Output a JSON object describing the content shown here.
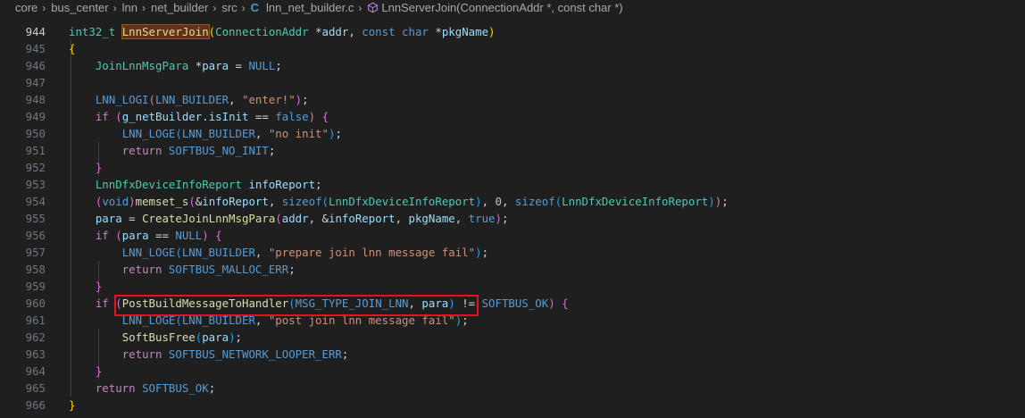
{
  "breadcrumb": {
    "parts": [
      "core",
      "bus_center",
      "lnn",
      "net_builder",
      "src"
    ],
    "file_icon_letter": "C",
    "file_name": "lnn_net_builder.c",
    "symbol": "LnnServerJoin(ConnectionAddr *, const char *)"
  },
  "colors": {
    "background": "#1f1f1f",
    "highlight_box": "#e81123",
    "keyword": "#569cd6",
    "control": "#c586c0",
    "type": "#4ec9b0",
    "function": "#dcdcaa",
    "variable": "#9cdcfe",
    "string": "#ce9178",
    "number": "#b5cea8"
  },
  "editor": {
    "active_line": "944",
    "lines": [
      {
        "n": "944",
        "tokens": [
          {
            "t": "int32_t",
            "c": "ty"
          },
          {
            "t": " ",
            "c": ""
          },
          {
            "t": "LnnServerJoin",
            "c": "fn sel"
          },
          {
            "t": "(",
            "c": "br1"
          },
          {
            "t": "ConnectionAddr",
            "c": "ty"
          },
          {
            "t": " *",
            "c": "pu"
          },
          {
            "t": "addr",
            "c": "va"
          },
          {
            "t": ", ",
            "c": "pu"
          },
          {
            "t": "const",
            "c": "k"
          },
          {
            "t": " ",
            "c": ""
          },
          {
            "t": "char",
            "c": "k"
          },
          {
            "t": " *",
            "c": "pu"
          },
          {
            "t": "pkgName",
            "c": "va"
          },
          {
            "t": ")",
            "c": "br1"
          }
        ]
      },
      {
        "n": "945",
        "tokens": [
          {
            "t": "{",
            "c": "br1"
          }
        ]
      },
      {
        "n": "946",
        "tokens": [
          {
            "t": "    ",
            "c": ""
          },
          {
            "t": "JoinLnnMsgPara",
            "c": "ty"
          },
          {
            "t": " *",
            "c": "pu"
          },
          {
            "t": "para",
            "c": "va"
          },
          {
            "t": " = ",
            "c": "pu"
          },
          {
            "t": "NULL",
            "c": "mc"
          },
          {
            "t": ";",
            "c": "pu"
          }
        ]
      },
      {
        "n": "947",
        "tokens": []
      },
      {
        "n": "948",
        "tokens": [
          {
            "t": "    ",
            "c": ""
          },
          {
            "t": "LNN_LOGI",
            "c": "mc"
          },
          {
            "t": "(",
            "c": "br2"
          },
          {
            "t": "LNN_BUILDER",
            "c": "mc"
          },
          {
            "t": ", ",
            "c": "pu"
          },
          {
            "t": "\"enter!\"",
            "c": "st"
          },
          {
            "t": ")",
            "c": "br2"
          },
          {
            "t": ";",
            "c": "pu"
          }
        ]
      },
      {
        "n": "949",
        "tokens": [
          {
            "t": "    ",
            "c": ""
          },
          {
            "t": "if",
            "c": "cf"
          },
          {
            "t": " ",
            "c": ""
          },
          {
            "t": "(",
            "c": "br2"
          },
          {
            "t": "g_netBuilder",
            "c": "va"
          },
          {
            "t": ".",
            "c": "pu"
          },
          {
            "t": "isInit",
            "c": "va"
          },
          {
            "t": " == ",
            "c": "pu"
          },
          {
            "t": "false",
            "c": "k"
          },
          {
            "t": ")",
            "c": "br2"
          },
          {
            "t": " ",
            "c": ""
          },
          {
            "t": "{",
            "c": "br2"
          }
        ]
      },
      {
        "n": "950",
        "tokens": [
          {
            "t": "        ",
            "c": ""
          },
          {
            "t": "LNN_LOGE",
            "c": "mc"
          },
          {
            "t": "(",
            "c": "br3"
          },
          {
            "t": "LNN_BUILDER",
            "c": "mc"
          },
          {
            "t": ", ",
            "c": "pu"
          },
          {
            "t": "\"no init\"",
            "c": "st"
          },
          {
            "t": ")",
            "c": "br3"
          },
          {
            "t": ";",
            "c": "pu"
          }
        ]
      },
      {
        "n": "951",
        "tokens": [
          {
            "t": "        ",
            "c": ""
          },
          {
            "t": "return",
            "c": "cf"
          },
          {
            "t": " ",
            "c": ""
          },
          {
            "t": "SOFTBUS_NO_INIT",
            "c": "mc"
          },
          {
            "t": ";",
            "c": "pu"
          }
        ]
      },
      {
        "n": "952",
        "tokens": [
          {
            "t": "    ",
            "c": ""
          },
          {
            "t": "}",
            "c": "br2"
          }
        ]
      },
      {
        "n": "953",
        "tokens": [
          {
            "t": "    ",
            "c": ""
          },
          {
            "t": "LnnDfxDeviceInfoReport",
            "c": "ty"
          },
          {
            "t": " ",
            "c": ""
          },
          {
            "t": "infoReport",
            "c": "va"
          },
          {
            "t": ";",
            "c": "pu"
          }
        ]
      },
      {
        "n": "954",
        "tokens": [
          {
            "t": "    ",
            "c": ""
          },
          {
            "t": "(",
            "c": "br2"
          },
          {
            "t": "void",
            "c": "k"
          },
          {
            "t": ")",
            "c": "br2"
          },
          {
            "t": "memset_s",
            "c": "fn"
          },
          {
            "t": "(",
            "c": "br2"
          },
          {
            "t": "&",
            "c": "pu"
          },
          {
            "t": "infoReport",
            "c": "va"
          },
          {
            "t": ", ",
            "c": "pu"
          },
          {
            "t": "sizeof",
            "c": "k"
          },
          {
            "t": "(",
            "c": "br3"
          },
          {
            "t": "LnnDfxDeviceInfoReport",
            "c": "ty"
          },
          {
            "t": ")",
            "c": "br3"
          },
          {
            "t": ", ",
            "c": "pu"
          },
          {
            "t": "0",
            "c": "nu"
          },
          {
            "t": ", ",
            "c": "pu"
          },
          {
            "t": "sizeof",
            "c": "k"
          },
          {
            "t": "(",
            "c": "br3"
          },
          {
            "t": "LnnDfxDeviceInfoReport",
            "c": "ty"
          },
          {
            "t": ")",
            "c": "br3"
          },
          {
            "t": ")",
            "c": "br2"
          },
          {
            "t": ";",
            "c": "pu"
          }
        ]
      },
      {
        "n": "955",
        "tokens": [
          {
            "t": "    ",
            "c": ""
          },
          {
            "t": "para",
            "c": "va"
          },
          {
            "t": " = ",
            "c": "pu"
          },
          {
            "t": "CreateJoinLnnMsgPara",
            "c": "fn"
          },
          {
            "t": "(",
            "c": "br2"
          },
          {
            "t": "addr",
            "c": "va"
          },
          {
            "t": ", ",
            "c": "pu"
          },
          {
            "t": "&",
            "c": "pu"
          },
          {
            "t": "infoReport",
            "c": "va"
          },
          {
            "t": ", ",
            "c": "pu"
          },
          {
            "t": "pkgName",
            "c": "va"
          },
          {
            "t": ", ",
            "c": "pu"
          },
          {
            "t": "true",
            "c": "k"
          },
          {
            "t": ")",
            "c": "br2"
          },
          {
            "t": ";",
            "c": "pu"
          }
        ]
      },
      {
        "n": "956",
        "tokens": [
          {
            "t": "    ",
            "c": ""
          },
          {
            "t": "if",
            "c": "cf"
          },
          {
            "t": " ",
            "c": ""
          },
          {
            "t": "(",
            "c": "br2"
          },
          {
            "t": "para",
            "c": "va"
          },
          {
            "t": " == ",
            "c": "pu"
          },
          {
            "t": "NULL",
            "c": "mc"
          },
          {
            "t": ")",
            "c": "br2"
          },
          {
            "t": " ",
            "c": ""
          },
          {
            "t": "{",
            "c": "br2"
          }
        ]
      },
      {
        "n": "957",
        "tokens": [
          {
            "t": "        ",
            "c": ""
          },
          {
            "t": "LNN_LOGE",
            "c": "mc"
          },
          {
            "t": "(",
            "c": "br3"
          },
          {
            "t": "LNN_BUILDER",
            "c": "mc"
          },
          {
            "t": ", ",
            "c": "pu"
          },
          {
            "t": "\"prepare join lnn message fail\"",
            "c": "st"
          },
          {
            "t": ")",
            "c": "br3"
          },
          {
            "t": ";",
            "c": "pu"
          }
        ]
      },
      {
        "n": "958",
        "tokens": [
          {
            "t": "        ",
            "c": ""
          },
          {
            "t": "return",
            "c": "cf"
          },
          {
            "t": " ",
            "c": ""
          },
          {
            "t": "SOFTBUS_MALLOC_ERR",
            "c": "mc"
          },
          {
            "t": ";",
            "c": "pu"
          }
        ]
      },
      {
        "n": "959",
        "tokens": [
          {
            "t": "    ",
            "c": ""
          },
          {
            "t": "}",
            "c": "br2"
          }
        ]
      },
      {
        "n": "960",
        "tokens": [
          {
            "t": "    ",
            "c": ""
          },
          {
            "t": "if",
            "c": "cf"
          },
          {
            "t": " ",
            "c": ""
          },
          {
            "t": "(",
            "c": "br2"
          },
          {
            "t": "PostBuildMessageToHandler",
            "c": "fn"
          },
          {
            "t": "(",
            "c": "br3"
          },
          {
            "t": "MSG_TYPE_JOIN_LNN",
            "c": "mc"
          },
          {
            "t": ", ",
            "c": "pu"
          },
          {
            "t": "para",
            "c": "va"
          },
          {
            "t": ")",
            "c": "br3"
          },
          {
            "t": " != ",
            "c": "pu"
          },
          {
            "t": "SOFTBUS_OK",
            "c": "mc"
          },
          {
            "t": ")",
            "c": "br2"
          },
          {
            "t": " ",
            "c": ""
          },
          {
            "t": "{",
            "c": "br2"
          }
        ]
      },
      {
        "n": "961",
        "tokens": [
          {
            "t": "        ",
            "c": ""
          },
          {
            "t": "LNN_LOGE",
            "c": "mc"
          },
          {
            "t": "(",
            "c": "br3"
          },
          {
            "t": "LNN_BUILDER",
            "c": "mc"
          },
          {
            "t": ", ",
            "c": "pu"
          },
          {
            "t": "\"post join lnn message fail\"",
            "c": "st"
          },
          {
            "t": ")",
            "c": "br3"
          },
          {
            "t": ";",
            "c": "pu"
          }
        ]
      },
      {
        "n": "962",
        "tokens": [
          {
            "t": "        ",
            "c": ""
          },
          {
            "t": "SoftBusFree",
            "c": "fn"
          },
          {
            "t": "(",
            "c": "br3"
          },
          {
            "t": "para",
            "c": "va"
          },
          {
            "t": ")",
            "c": "br3"
          },
          {
            "t": ";",
            "c": "pu"
          }
        ]
      },
      {
        "n": "963",
        "tokens": [
          {
            "t": "        ",
            "c": ""
          },
          {
            "t": "return",
            "c": "cf"
          },
          {
            "t": " ",
            "c": ""
          },
          {
            "t": "SOFTBUS_NETWORK_LOOPER_ERR",
            "c": "mc"
          },
          {
            "t": ";",
            "c": "pu"
          }
        ]
      },
      {
        "n": "964",
        "tokens": [
          {
            "t": "    ",
            "c": ""
          },
          {
            "t": "}",
            "c": "br2"
          }
        ]
      },
      {
        "n": "965",
        "tokens": [
          {
            "t": "    ",
            "c": ""
          },
          {
            "t": "return",
            "c": "cf"
          },
          {
            "t": " ",
            "c": ""
          },
          {
            "t": "SOFTBUS_OK",
            "c": "mc"
          },
          {
            "t": ";",
            "c": "pu"
          }
        ]
      },
      {
        "n": "966",
        "tokens": [
          {
            "t": "}",
            "c": "br1"
          }
        ]
      }
    ]
  }
}
